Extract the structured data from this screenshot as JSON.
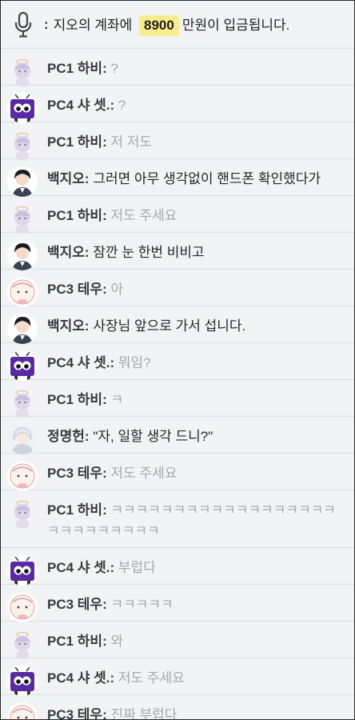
{
  "narration": {
    "icon": "microphone-icon",
    "colon": ":",
    "pre": "지오의 계좌에",
    "amount": "8900",
    "post": "만원이 입금됩니다.",
    "highlight_color": "#f9ec8f"
  },
  "messages": [
    {
      "speaker": "PC1 하비:",
      "text": "?",
      "avatar": "habi",
      "tone": "gray"
    },
    {
      "speaker": "PC4 샤 셋.:",
      "text": "?",
      "avatar": "tv",
      "tone": "gray"
    },
    {
      "speaker": "PC1 하비:",
      "text": "저 저도",
      "avatar": "habi",
      "tone": "gray"
    },
    {
      "speaker": "백지오:",
      "text": "그러면 아무 생각없이 핸드폰 확인했다가",
      "avatar": "jio",
      "tone": "dark"
    },
    {
      "speaker": "PC1 하비:",
      "text": "저도 주세요",
      "avatar": "habi",
      "tone": "gray"
    },
    {
      "speaker": "백지오:",
      "text": "잠깐 눈 한번 비비고",
      "avatar": "jio",
      "tone": "dark"
    },
    {
      "speaker": "PC3 테우:",
      "text": "아",
      "avatar": "teu",
      "tone": "gray"
    },
    {
      "speaker": "백지오:",
      "text": "사장님 앞으로 가서 섭니다.",
      "avatar": "jio",
      "tone": "dark"
    },
    {
      "speaker": "PC4 샤 셋.:",
      "text": "뭐임?",
      "avatar": "tv",
      "tone": "gray"
    },
    {
      "speaker": "PC1 하비:",
      "text": "ㅋ",
      "avatar": "habi",
      "tone": "gray"
    },
    {
      "speaker": "정명헌:",
      "text": "\"자, 일할 생각 드니?\"",
      "avatar": "jung",
      "tone": "dark"
    },
    {
      "speaker": "PC3 테우:",
      "text": "저도 주세요",
      "avatar": "teu",
      "tone": "gray"
    },
    {
      "speaker": "PC1 하비:",
      "text": "ㅋㅋㅋㅋㅋㅋㅋㅋㅋㅋㅋㅋㅋㅋㅋㅋㅋㅋㅋㅋㅋㅋㅋㅋㅋㅋㅋ",
      "avatar": "habi",
      "tone": "gray"
    },
    {
      "speaker": "PC4 샤 셋.:",
      "text": "부럽다",
      "avatar": "tv",
      "tone": "gray"
    },
    {
      "speaker": "PC3 테우:",
      "text": "ㅋㅋㅋㅋㅋ",
      "avatar": "teu",
      "tone": "gray"
    },
    {
      "speaker": "PC1 하비:",
      "text": "와",
      "avatar": "habi",
      "tone": "gray"
    },
    {
      "speaker": "PC4 샤 셋.:",
      "text": "저도 주세요",
      "avatar": "tv",
      "tone": "gray"
    },
    {
      "speaker": "PC3 테우:",
      "text": "진짜 부럽다",
      "avatar": "teu",
      "tone": "gray"
    }
  ]
}
